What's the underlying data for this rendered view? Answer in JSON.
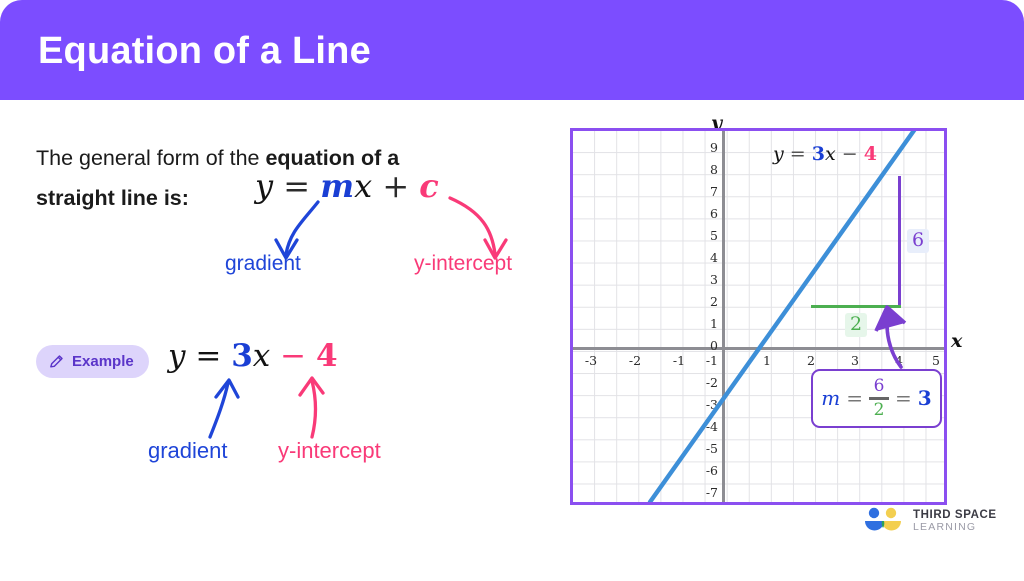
{
  "header": {
    "title": "Equation of a Line"
  },
  "intro": {
    "line1_plain": "The general form of the ",
    "line1_bold": "equation of a",
    "line2_bold": "straight line is:"
  },
  "general_equation": {
    "y": "y",
    "equals": "=",
    "m": "m",
    "x": "x",
    "plus": "+",
    "c": "c",
    "gradient_label": "gradient",
    "intercept_label": "y-intercept"
  },
  "example": {
    "badge_label": "Example",
    "badge_icon": "pencil-icon",
    "y": "y",
    "equals": "=",
    "slope": "3",
    "x": "x",
    "minus": "−",
    "intercept": "4",
    "gradient_label": "gradient",
    "intercept_label": "y-intercept"
  },
  "graph": {
    "equation_label": {
      "y": "y",
      "equals": "=",
      "slope": "3",
      "x": "x",
      "minus": "−",
      "intercept": "4"
    },
    "x_axis_name": "x",
    "y_axis_name": "y",
    "rise_label": "6",
    "run_label": "2",
    "gradient_box": {
      "m": "m",
      "equals1": "=",
      "numerator": "6",
      "denominator": "2",
      "equals2": "=",
      "result": "3"
    }
  },
  "logo": {
    "line1": "THIRD SPACE",
    "line2": "LEARNING",
    "icon": "third-space-learning-logo-icon"
  },
  "colors": {
    "header_purple": "#7c4dff",
    "blue": "#1a3fd4",
    "pink": "#f93a78",
    "graph_line_blue": "#3d8fd8",
    "rise_purple": "#7a3fd0",
    "run_green": "#4caf50",
    "badge_bg": "#ddd4fb",
    "badge_text": "#5b35c9"
  },
  "chart_data": {
    "type": "line",
    "title": "y = 3x - 4",
    "xlabel": "x",
    "ylabel": "y",
    "xlim": [
      -3.5,
      5.5
    ],
    "ylim": [
      -7.5,
      9.5
    ],
    "grid": true,
    "legend": "none",
    "xticks": [
      "-3",
      "-2",
      "-1",
      "0",
      "1",
      "2",
      "3",
      "4",
      "5"
    ],
    "yticks": [
      "9",
      "8",
      "7",
      "6",
      "5",
      "4",
      "3",
      "2",
      "1",
      "0",
      "-1",
      "-2",
      "-3",
      "-4",
      "-5",
      "-6",
      "-7"
    ],
    "series": [
      {
        "name": "y = 3x - 4",
        "slope": 3,
        "intercept": -4,
        "color": "#3d8fd8",
        "x": [
          -1.2,
          4.4
        ],
        "values": [
          -7.6,
          9.2
        ]
      },
      {
        "name": "rise",
        "color": "#7a3fd0",
        "x": [
          4,
          4
        ],
        "values": [
          2,
          8
        ],
        "label": "6"
      },
      {
        "name": "run",
        "color": "#4caf50",
        "x": [
          2,
          4
        ],
        "values": [
          2,
          2
        ],
        "label": "2"
      }
    ],
    "annotations": [
      {
        "text": "y = 3x - 4",
        "x": 1.6,
        "y": 8.5
      },
      {
        "text": "6",
        "x": 4.3,
        "y": 5
      },
      {
        "text": "2",
        "x": 3,
        "y": 1.4
      },
      {
        "text": "m = 6/2 = 3",
        "x": 3.2,
        "y": -2.6
      }
    ]
  }
}
